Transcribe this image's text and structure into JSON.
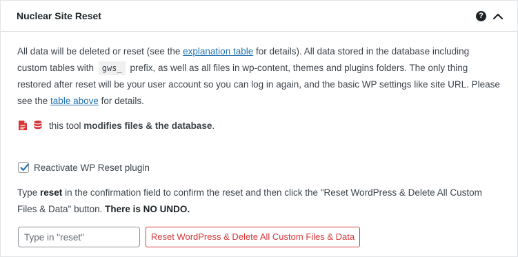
{
  "header": {
    "title": "Nuclear Site Reset",
    "help_glyph": "?"
  },
  "description": {
    "part1": "All data will be deleted or reset (see the ",
    "link1": "explanation table",
    "part2": " for details). All data stored in the database including custom tables with ",
    "code": "gws_",
    "part3": " prefix, as well as all files in wp-content, themes and plugins folders. The only thing restored after reset will be your user account so you can log in again, and the basic WP settings like site URL. Please see the ",
    "link2": "table above",
    "part4": " for details."
  },
  "warning": {
    "prefix": "this tool ",
    "strong": "modifies files & the database",
    "suffix": ".",
    "icons": [
      "file-icon",
      "database-icon"
    ],
    "icon_color": "#d63638"
  },
  "reactivate": {
    "label": "Reactivate WP Reset plugin",
    "checked": true
  },
  "confirm": {
    "part1": "Type ",
    "keyword": "reset",
    "part2": " in the confirmation field to confirm the reset and then click the \"Reset WordPress & Delete All Custom Files & Data\" button. ",
    "strong": "There is NO UNDO."
  },
  "form": {
    "input_placeholder": "Type in \"reset\"",
    "input_value": "",
    "button_label": "Reset WordPress & Delete All Custom Files & Data"
  },
  "colors": {
    "link": "#2271b1",
    "danger": "#d63638",
    "text": "#3c434a",
    "checkbox_accent": "#2271b1"
  }
}
